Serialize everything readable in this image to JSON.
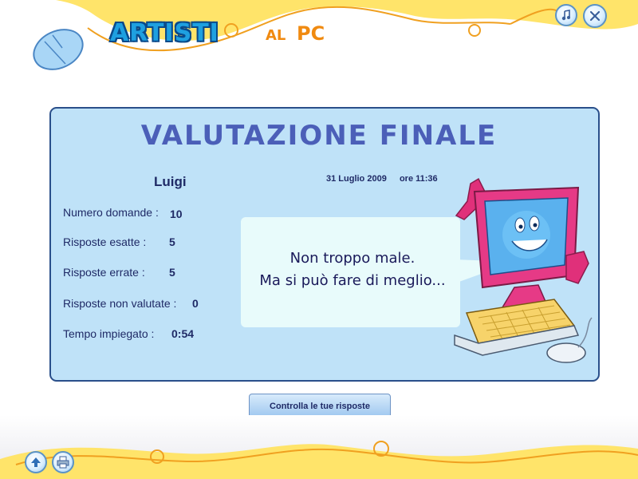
{
  "header": {
    "title_main": "ARTISTI",
    "title_al": "AL",
    "title_pc": "PC"
  },
  "toolbar": {
    "sound_icon": "music-note-icon",
    "close_icon": "close-icon",
    "home_icon": "up-arrow-icon",
    "print_icon": "printer-icon"
  },
  "panel": {
    "title": "VALUTAZIONE FINALE",
    "user": "Luigi",
    "date": "31 Luglio 2009",
    "time": "ore 11:36",
    "stats": [
      {
        "label": "Numero domande :",
        "value": "10"
      },
      {
        "label": "Risposte esatte :",
        "value": "5"
      },
      {
        "label": "Risposte errate :",
        "value": "5"
      },
      {
        "label": "Risposte non valutate :",
        "value": "0"
      },
      {
        "label": "Tempo impiegato :",
        "value": "0:54"
      }
    ],
    "bubble_line1": "Non troppo male.",
    "bubble_line2": "Ma si può fare di meglio..."
  },
  "actions": {
    "check_answers": "Controlla le tue risposte"
  },
  "colors": {
    "panel_bg": "#bfe2f8",
    "accent_yellow": "#ffe46a",
    "accent_orange": "#f08a10",
    "title_blue": "#4b5fb8"
  }
}
